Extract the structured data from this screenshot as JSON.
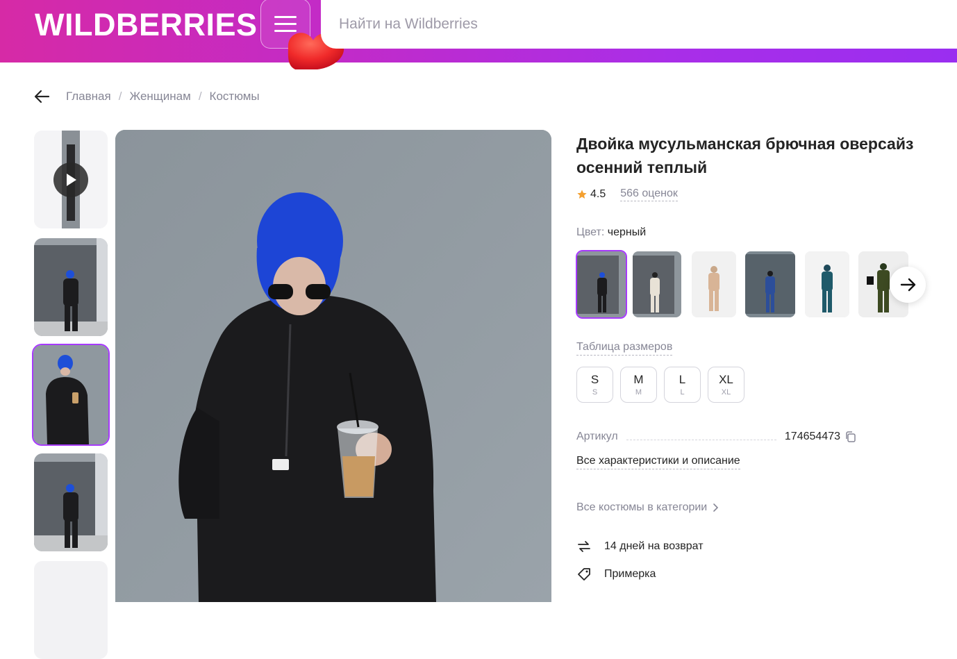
{
  "header": {
    "logo": "WILDBERRIES",
    "search_placeholder": "Найти на Wildberries"
  },
  "breadcrumb": [
    "Главная",
    "Женщинам",
    "Костюмы"
  ],
  "product": {
    "title": "Двойка мусульманская брючная оверсайз осенний теплый",
    "rating": "4.5",
    "reviews": "566 оценок",
    "color_label": "Цвет:",
    "color_value": "черный",
    "size_table_label": "Таблица размеров",
    "sizes": [
      {
        "main": "S",
        "sub": "S"
      },
      {
        "main": "M",
        "sub": "M"
      },
      {
        "main": "L",
        "sub": "L"
      },
      {
        "main": "XL",
        "sub": "XL"
      }
    ],
    "article_label": "Артикул",
    "article_value": "174654473",
    "all_specs": "Все характеристики и описание",
    "category_link": "Все костюмы в категории",
    "features": [
      "14 дней на возврат",
      "Примерка"
    ]
  },
  "colors": {
    "accent": "#a73afd",
    "header_gradient_start": "#d62aa6",
    "header_gradient_end": "#9a2ef0",
    "star": "#f4a030"
  }
}
